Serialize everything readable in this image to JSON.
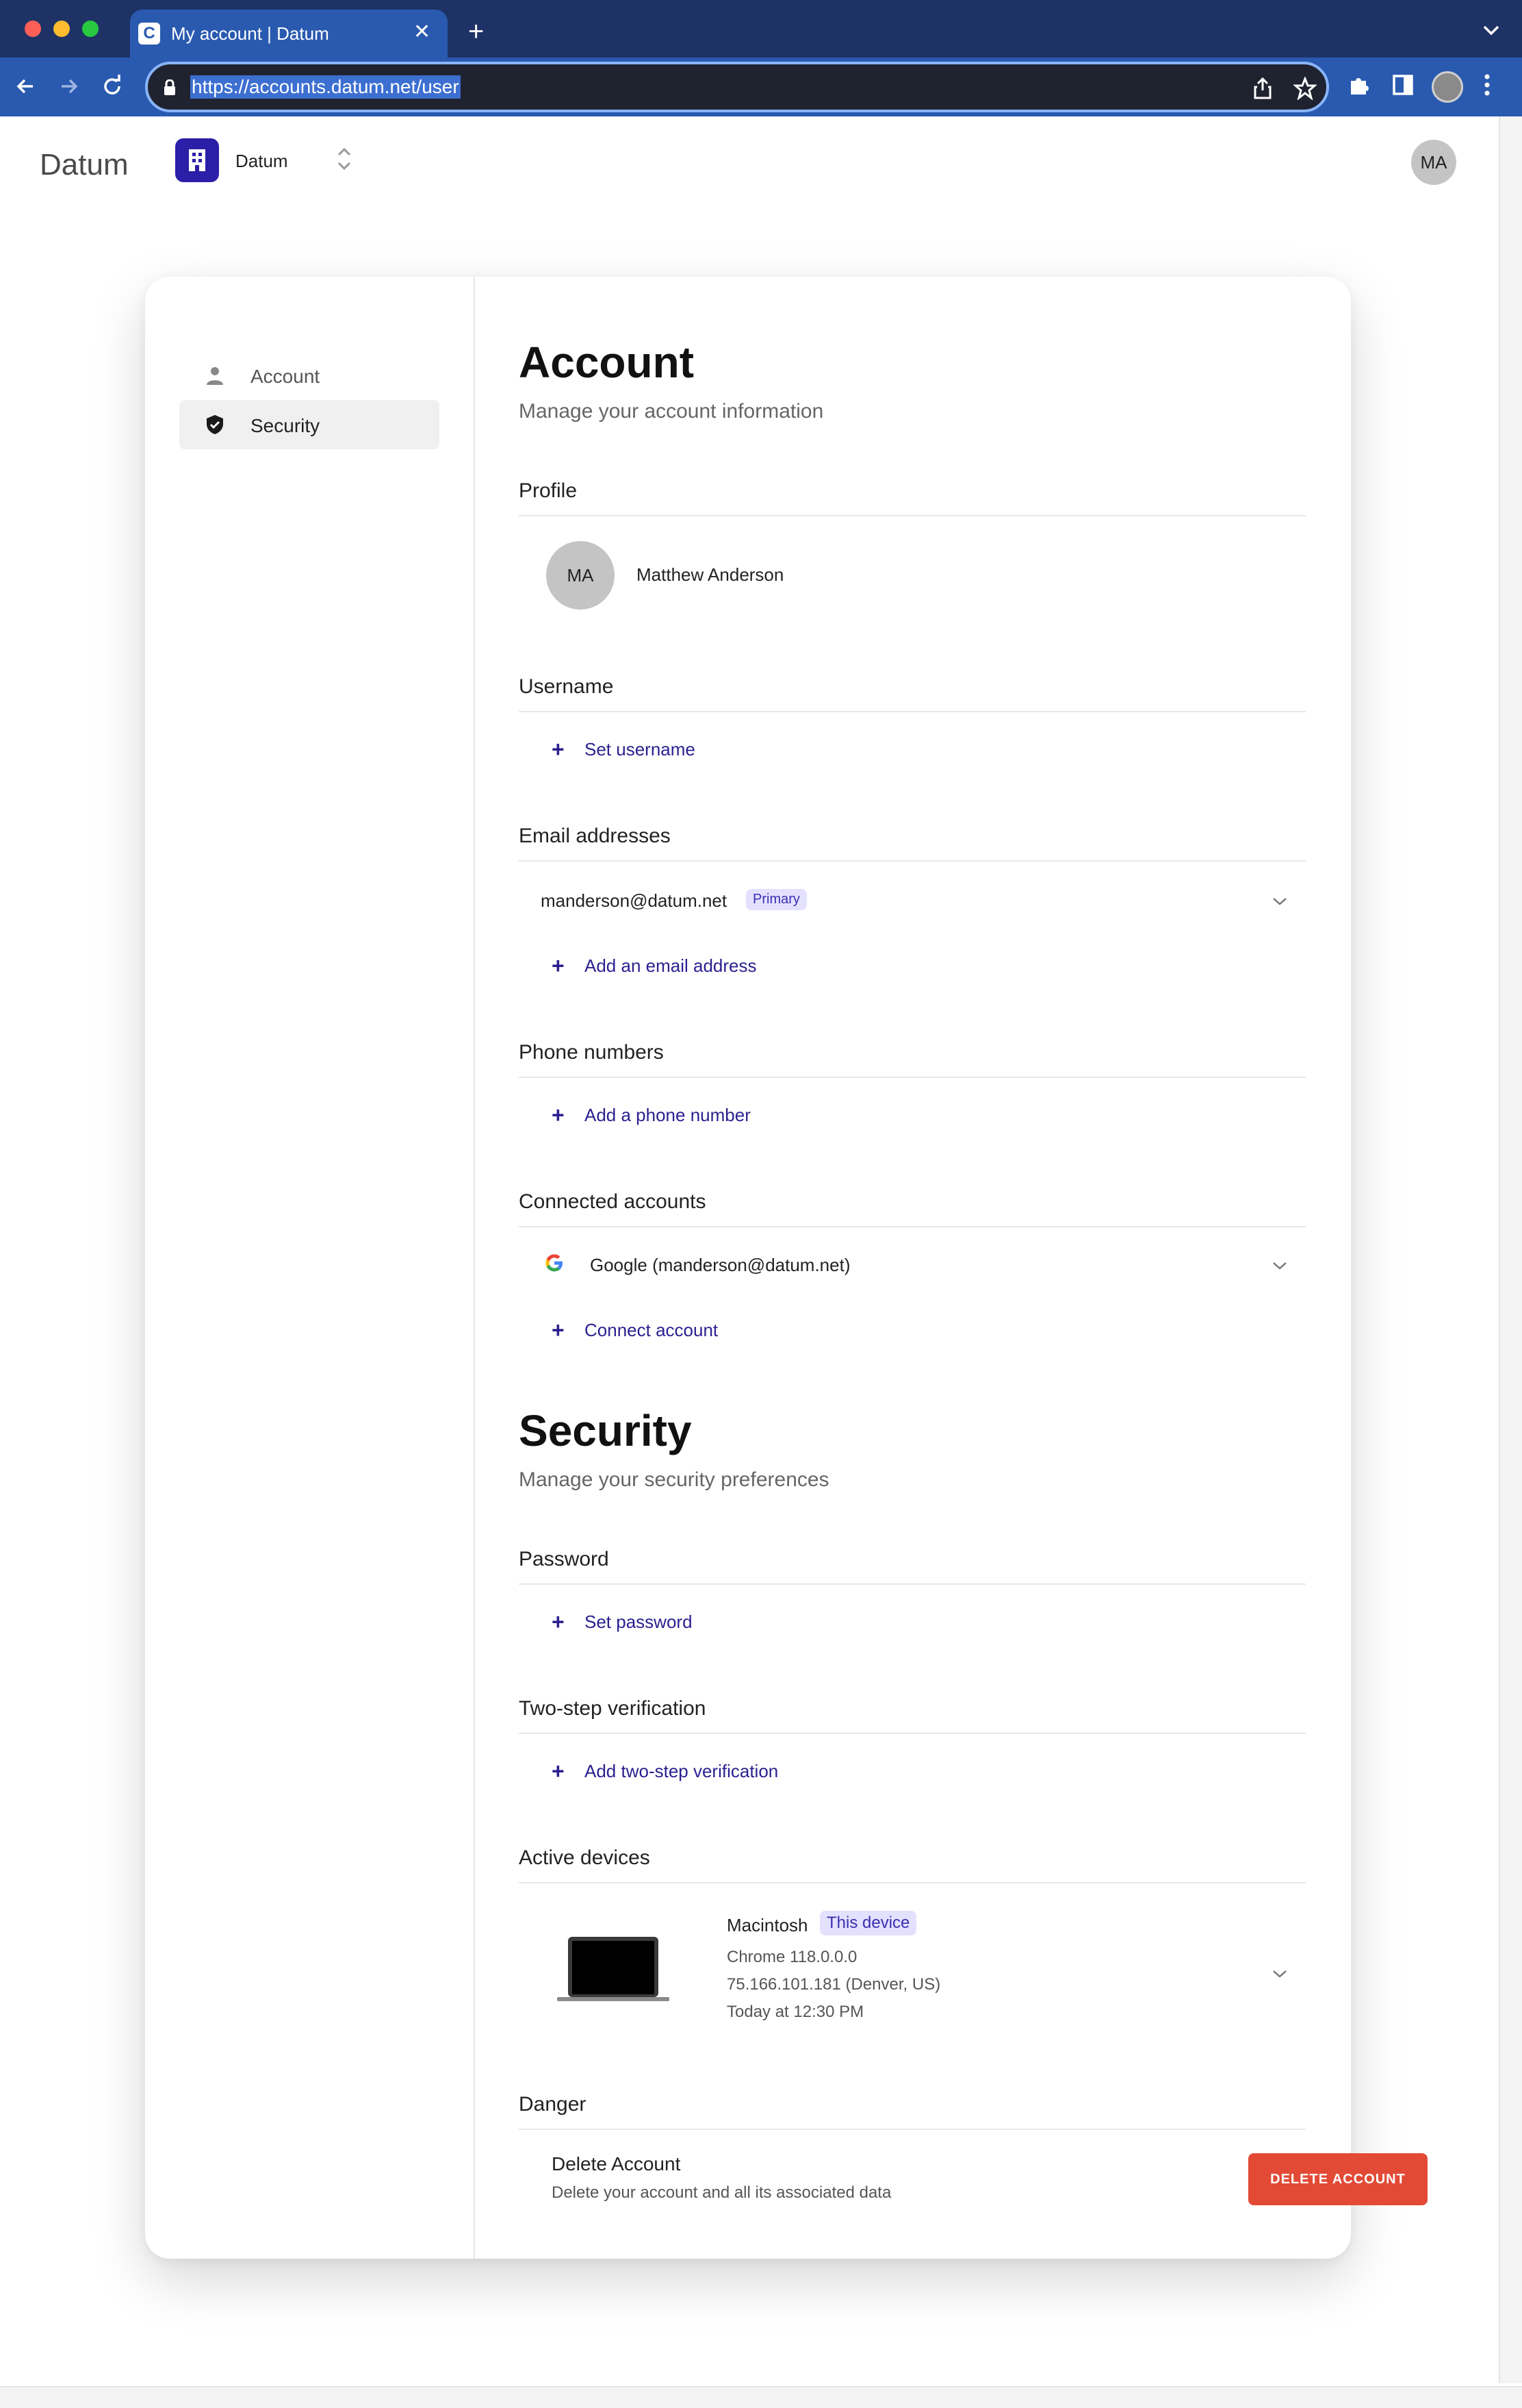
{
  "browser": {
    "tab_title": "My account | Datum",
    "url": "https://accounts.datum.net/user",
    "tab_close": "✕",
    "new_tab": "+"
  },
  "header": {
    "brand": "Datum",
    "org_name": "Datum",
    "user_initials": "MA"
  },
  "sidebar": {
    "items": [
      {
        "label": "Account",
        "icon": "person-icon",
        "active": false
      },
      {
        "label": "Security",
        "icon": "shield-icon",
        "active": true
      }
    ]
  },
  "account": {
    "title": "Account",
    "subtitle": "Manage your account information",
    "profile": {
      "title": "Profile",
      "initials": "MA",
      "name": "Matthew Anderson"
    },
    "username": {
      "title": "Username",
      "action": "Set username"
    },
    "emails": {
      "title": "Email addresses",
      "address": "manderson@datum.net",
      "badge": "Primary",
      "action": "Add an email address"
    },
    "phones": {
      "title": "Phone numbers",
      "action": "Add a phone number"
    },
    "connected": {
      "title": "Connected accounts",
      "account": "Google (manderson@datum.net)",
      "action": "Connect account"
    }
  },
  "security": {
    "title": "Security",
    "subtitle": "Manage your security preferences",
    "password": {
      "title": "Password",
      "action": "Set password"
    },
    "two_step": {
      "title": "Two-step verification",
      "action": "Add two-step verification"
    },
    "devices": {
      "title": "Active devices",
      "name": "Macintosh",
      "badge": "This device",
      "browser": "Chrome 118.0.0.0",
      "ip": "75.166.101.181 (Denver, US)",
      "time": "Today at 12:30 PM"
    },
    "danger": {
      "title": "Danger",
      "item_title": "Delete Account",
      "item_desc": "Delete your account and all its associated data",
      "button": "DELETE ACCOUNT"
    }
  },
  "colors": {
    "accent": "#2b1f8f",
    "danger": "#e24a36",
    "badge_bg": "#e4e0ff",
    "chrome_dark": "#1e3266",
    "chrome_blue": "#2a5ab0"
  }
}
